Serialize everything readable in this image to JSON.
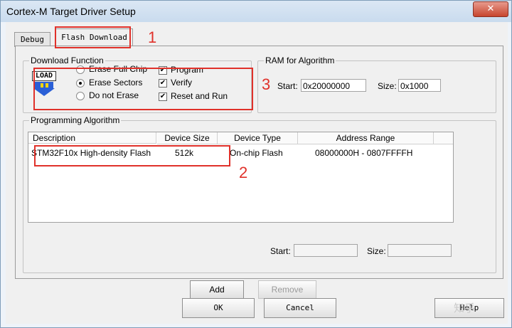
{
  "window": {
    "title": "Cortex-M Target Driver Setup",
    "close_glyph": "✕"
  },
  "tabs": [
    {
      "label": "Debug"
    },
    {
      "label": "Flash Download"
    }
  ],
  "download": {
    "group_label": "Download Function",
    "load_icon": {
      "text": "LOAD"
    },
    "radios": [
      {
        "label": "Erase Full Chip",
        "checked": false
      },
      {
        "label": "Erase Sectors",
        "checked": true
      },
      {
        "label": "Do not Erase",
        "checked": false
      }
    ],
    "checks": [
      {
        "label": "Program",
        "checked": true
      },
      {
        "label": "Verify",
        "checked": true
      },
      {
        "label": "Reset and Run",
        "checked": true
      }
    ]
  },
  "ram": {
    "group_label": "RAM for Algorithm",
    "start_label": "Start:",
    "start_value": "0x20000000",
    "size_label": "Size:",
    "size_value": "0x1000"
  },
  "algo": {
    "group_label": "Programming Algorithm",
    "columns": [
      "Description",
      "Device Size",
      "Device Type",
      "Address Range"
    ],
    "row": {
      "description": "STM32F10x High-density Flash",
      "size": "512k",
      "type": "On-chip Flash",
      "range": "08000000H - 0807FFFFH"
    },
    "start_label": "Start:",
    "start_value": "",
    "size_label": "Size:",
    "size_value": ""
  },
  "buttons": {
    "add": "Add",
    "remove": "Remove",
    "ok": "OK",
    "cancel": "Cancel",
    "help": "Help"
  },
  "annotations": [
    "1",
    "2",
    "3"
  ],
  "watermark": "知乎",
  "colors": {
    "annotation": "#e0312a",
    "titlebar": "#c9dbee"
  }
}
